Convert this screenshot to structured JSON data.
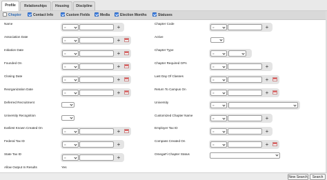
{
  "tabs": [
    {
      "label": "Profile",
      "active": true
    },
    {
      "label": "Relationships",
      "active": false
    },
    {
      "label": "Housing",
      "active": false
    },
    {
      "label": "Discipline",
      "active": false
    }
  ],
  "sections": [
    {
      "label": "Chapter",
      "checked": false
    },
    {
      "label": "Contact Info",
      "checked": true
    },
    {
      "label": "Custom Fields",
      "checked": true
    },
    {
      "label": "Media",
      "checked": true
    },
    {
      "label": "Election Months",
      "checked": true
    },
    {
      "label": "Statuses",
      "checked": true
    }
  ],
  "operator_default": "=",
  "left_fields": {
    "name": "Name",
    "association_date": "Association Date",
    "initiation_date": "Initiation Date",
    "founded_on": "Founded On",
    "closing_date": "Closing Date",
    "reorganization_date": "Reorganization Date",
    "deferred_recruitment": "Deferred Recruitment",
    "university_recognition": "University Recognition",
    "earliest_known_created_on": "Earliest Known Created On",
    "federal_tax_id": "Federal Tax ID",
    "state_tax_id": "State Tax ID",
    "allow_output_in_results": "Allow Output In Results",
    "allow_output_value": "Yes"
  },
  "right_fields": {
    "chapter_code": "Chapter Code",
    "active": "Active",
    "chapter_type": "Chapter Type",
    "chapter_required_gpa": "Chapter Required GPA",
    "last_day_of_classes": "Last Day Of Classes",
    "return_to_campus_on": "Return To Campus On",
    "university": "University",
    "customized_chapter_name": "Customized Chapter Name",
    "employer_tax_id": "Employer Tax ID",
    "compass_created_on": "Compass Created On",
    "omegafi_chapter_status": "OmegaFi Chapter Status"
  },
  "buttons": {
    "new_search": "New Search",
    "search": "Search"
  },
  "colors": {
    "checkbox_on": "#3d7fe0",
    "active_section": "#3a72b8",
    "calendar_icon": "#d66666"
  }
}
